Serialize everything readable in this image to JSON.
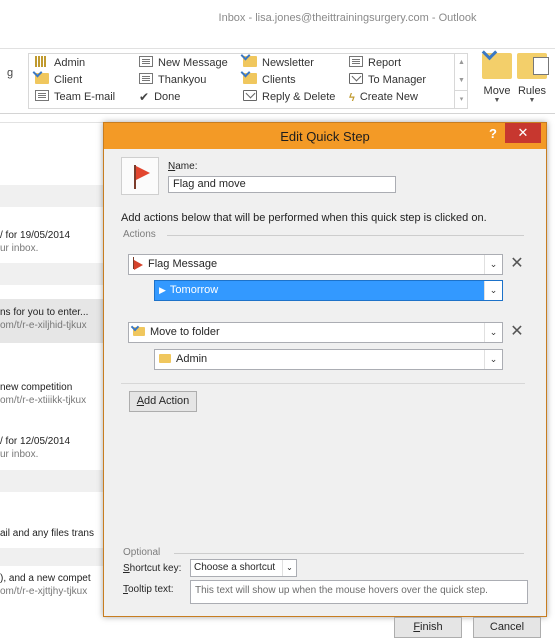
{
  "window": {
    "title": "Inbox - lisa.jones@theittrainingsurgery.com - Outlook"
  },
  "ribbon": {
    "fragment": "g",
    "quick_steps": [
      {
        "label": "Admin",
        "icon": "grid-icon"
      },
      {
        "label": "New Message",
        "icon": "mail-icon"
      },
      {
        "label": "Newsletter",
        "icon": "folder-move-icon"
      },
      {
        "label": "Report",
        "icon": "mail-icon"
      },
      {
        "label": "Client",
        "icon": "folder-move-icon"
      },
      {
        "label": "Thankyou",
        "icon": "mail-icon"
      },
      {
        "label": "Clients",
        "icon": "folder-move-icon"
      },
      {
        "label": "To Manager",
        "icon": "forward-icon"
      },
      {
        "label": "Team E-mail",
        "icon": "mail-icon"
      },
      {
        "label": "Done",
        "icon": "check-icon"
      },
      {
        "label": "Reply & Delete",
        "icon": "reply-icon"
      },
      {
        "label": "Create New",
        "icon": "bolt-icon"
      }
    ],
    "move_label": "Move",
    "rules_label": "Rules"
  },
  "left_list": [
    {
      "main": "/ for 19/05/2014",
      "sub": "ur inbox."
    },
    {
      "main": "ns for you to enter...",
      "sub": "om/t/r-e-xiljhid-tjkux"
    },
    {
      "main": " new competition",
      "sub": "om/t/r-e-xtiiikk-tjkux"
    },
    {
      "main": "/ for 12/05/2014",
      "sub": "ur inbox."
    },
    {
      "main": "ail and any files trans",
      "sub": ""
    },
    {
      "main": "), and a new compet",
      "sub": "om/t/r-e-xjttjhy-tjkux"
    }
  ],
  "right_strip": [
    "C",
    "ea",
    "e",
    "C",
    "C"
  ],
  "dialog": {
    "title": "Edit Quick Step",
    "help": "?",
    "close": "✕",
    "name_label_prefix": "N",
    "name_label_rest": "ame:",
    "name_value": "Flag and move",
    "instruction": "Add actions below that will be performed when this quick step is clicked on.",
    "actions_legend": "Actions",
    "actions": [
      {
        "type": "Flag Message",
        "option": "Tomorrow"
      },
      {
        "type": "Move to folder",
        "option": "Admin"
      }
    ],
    "add_action_prefix": "A",
    "add_action_rest": "dd Action",
    "optional_legend": "Optional",
    "shortcut_label_prefix": "S",
    "shortcut_label_rest": "hortcut key:",
    "shortcut_value": "Choose a shortcut",
    "tooltip_label_prefix": "T",
    "tooltip_label_rest": "ooltip text:",
    "tooltip_placeholder": "This text will show up when the mouse hovers over the quick step.",
    "finish_prefix": "F",
    "finish_rest": "inish",
    "cancel": "Cancel"
  }
}
